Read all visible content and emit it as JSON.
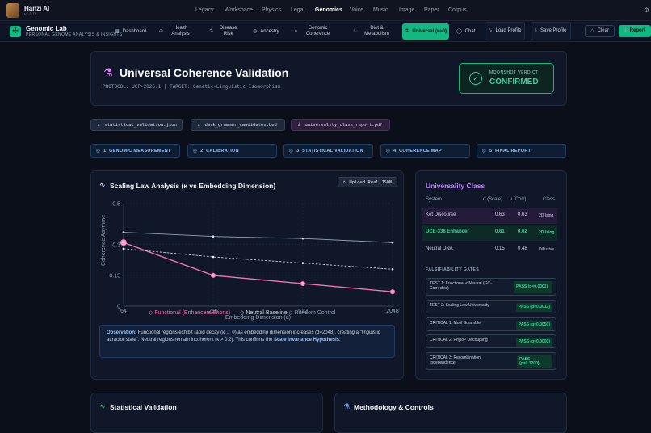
{
  "app": {
    "name": "Hanzi AI",
    "version": "v1.0.0"
  },
  "nav": [
    "Legacy",
    "Workspace",
    "Physics",
    "Legal",
    "Genomics",
    "Voice",
    "Music",
    "Image",
    "Paper",
    "Corpus"
  ],
  "nav_active": "Genomics",
  "lab": {
    "title": "Genomic Lab",
    "subtitle": "PERSONAL GENOME ANALYSIS & INSIGHTS"
  },
  "tabs": {
    "dashboard": "Dashboard",
    "health": "Health Analysis",
    "disease": "Disease Risk",
    "ancestry": "Ancestry",
    "coherence": "Genomic Coherence",
    "diet": "Diet & Metabolism",
    "universal": "Universal (κ≈0)",
    "chat": "Chat",
    "load": "Load Profile",
    "save": "Save Profile",
    "clear": "Clear",
    "report": "Report"
  },
  "header": {
    "title": "Universal Coherence Validation",
    "protocol": "PROTOCOL: UCP-2026.1  |  TARGET: Genetic-Linguistic Isomorphism",
    "verdict_label": "MOONSHOT VERDICT",
    "verdict_value": "CONFIRMED"
  },
  "files": [
    "statistical_validation.json",
    "dark_grammar_candidates.bed",
    "universality_class_report.pdf"
  ],
  "steps": [
    "1. GENOMIC MEASUREMENT",
    "2. CALIBRATION",
    "3. STATISTICAL VALIDATION",
    "4. COHERENCE MAP",
    "5. FINAL REPORT"
  ],
  "scaling": {
    "title": "Scaling Law Analysis (κ vs Embedding Dimension)",
    "upload": "Upload Real JSON",
    "observation_label": "Observation:",
    "observation_text": "Functional regions exhibit rapid decay (κ → 0) as embedding dimension increases (d=2048), creating a \"linguistic attractor state\". Neutral regions remain incoherent (κ > 0.2). This confirms the",
    "observation_bold": "Scale Invariance Hypothesis",
    "observation_end": "."
  },
  "chart_data": {
    "type": "line",
    "title": "",
    "xlabel": "Embedding Dimension (d)",
    "ylabel": "Coherence Asymme",
    "x": [
      64,
      256,
      512,
      2048
    ],
    "x_tick_labels": [
      "64",
      "256",
      "512",
      "2048"
    ],
    "ylim": [
      0,
      0.5
    ],
    "y_ticks": [
      "0",
      "0.15",
      "0.3",
      "0.5"
    ],
    "grid": true,
    "legend": "bottom",
    "series": [
      {
        "name": "Functional (Enhancers/Exons)",
        "values": [
          0.31,
          0.15,
          0.11,
          0.07
        ],
        "color": "#f472b6"
      },
      {
        "name": "Neutral Baseline",
        "values": [
          0.36,
          0.34,
          0.33,
          0.31
        ],
        "color": "#94a3b8"
      },
      {
        "name": "Random Control",
        "values": [
          0.28,
          0.24,
          0.21,
          0.18
        ],
        "color": "#cbd5e1"
      }
    ]
  },
  "universality": {
    "title": "Universality Class",
    "headers": [
      "System",
      "α (Scale)",
      "ν (Corr)",
      "Class"
    ],
    "rows": [
      {
        "system": "Ket Discourse",
        "alpha": "0.63",
        "nu": "0.63",
        "cls": "2D Ising"
      },
      {
        "system": "UCE-338 Enhancer",
        "alpha": "0.61",
        "nu": "0.62",
        "cls": "2D Ising"
      },
      {
        "system": "Neutral DNA",
        "alpha": "0.15",
        "nu": "0.48",
        "cls": "Diffusive"
      }
    ],
    "falsifiability": "FALSIFIABILITY GATES",
    "gates": [
      {
        "label": "TEST 1: Functional < Neutral (GC-Corrected)",
        "result": "PASS (p<0.0001)"
      },
      {
        "label": "TEST 2: Scaling Law Universality",
        "result": "PASS (p=0.0012)"
      },
      {
        "label": "CRITICAL 1: Motif Scramble",
        "result": "PASS (p=0.0050)"
      },
      {
        "label": "CRITICAL 2: PhyloP Decoupling",
        "result": "PASS (p=0.0000)"
      },
      {
        "label": "CRITICAL 3: Recombination Independence",
        "result": "PASS (p=0.1200)"
      }
    ]
  },
  "bottom": {
    "stat": "Statistical Validation",
    "method": "Methodology & Controls"
  }
}
